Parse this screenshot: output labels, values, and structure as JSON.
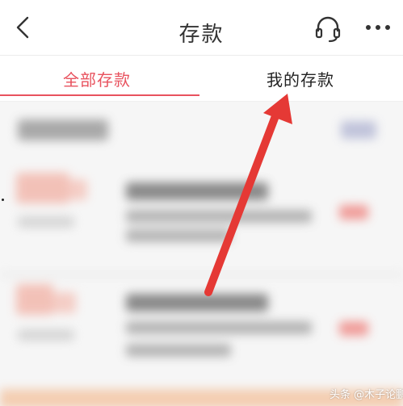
{
  "nav": {
    "title": "存款",
    "back_icon": "chevron-left-icon",
    "support_icon": "headset-icon",
    "more_icon": "ellipsis-icon"
  },
  "tabs": [
    {
      "label": "全部存款",
      "active": true
    },
    {
      "label": "我的存款",
      "active": false
    }
  ],
  "colors": {
    "accent": "#e8525e",
    "arrow": "#e53935",
    "title_text": "#333333"
  },
  "watermark": {
    "text": "头条 @木子论鹏"
  }
}
